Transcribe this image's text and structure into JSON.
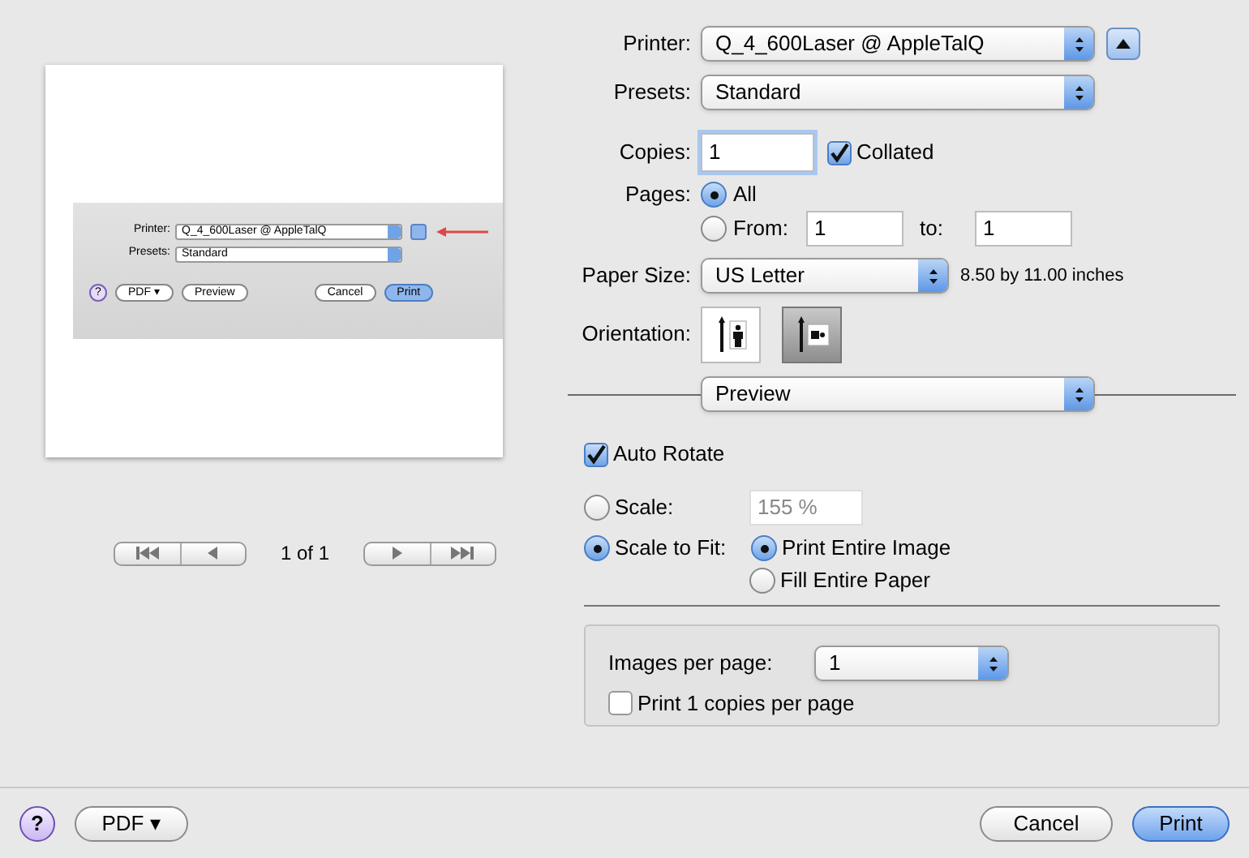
{
  "preview": {
    "screenshot": {
      "printer_label": "Printer:",
      "printer_value": "Q_4_600Laser @ AppleTalQ",
      "presets_label": "Presets:",
      "presets_value": "Standard",
      "help": "?",
      "buttons": [
        {
          "label": "PDF ▾",
          "kind": "plain"
        },
        {
          "label": "Preview",
          "kind": "plain"
        },
        {
          "label": "Cancel",
          "kind": "plain"
        },
        {
          "label": "Print",
          "kind": "default"
        }
      ]
    },
    "page_indicator": "1 of 1"
  },
  "printer": {
    "label": "Printer:",
    "value": "Q_4_600Laser @ AppleTalQ"
  },
  "presets": {
    "label": "Presets:",
    "value": "Standard"
  },
  "copies": {
    "label": "Copies:",
    "value": "1"
  },
  "collated": {
    "label": "Collated",
    "checked": true
  },
  "pages": {
    "label": "Pages:",
    "options": [
      {
        "label": "All",
        "selected": true
      },
      {
        "label": "From:",
        "selected": false
      }
    ],
    "from": "1",
    "to_label": "to:",
    "to": "1"
  },
  "paper_size": {
    "label": "Paper Size:",
    "value": "US Letter",
    "dimensions": "8.50 by 11.00 inches"
  },
  "orientation": {
    "label": "Orientation:",
    "options": [
      {
        "kind": "portrait",
        "selected": false
      },
      {
        "kind": "landscape",
        "selected": true
      }
    ]
  },
  "section": "Preview",
  "auto_rotate": {
    "label": "Auto Rotate",
    "checked": true
  },
  "scale": {
    "options": [
      {
        "label": "Scale:",
        "selected": false
      },
      {
        "label": "Scale to Fit:",
        "selected": true
      }
    ],
    "value": "155 %",
    "fit_options": [
      {
        "label": "Print Entire Image",
        "selected": true
      },
      {
        "label": "Fill Entire Paper",
        "selected": false
      }
    ]
  },
  "images_per_page": {
    "label": "Images per page:",
    "value": "1"
  },
  "copies_per_page": {
    "label": "Print 1 copies per page",
    "checked": false
  },
  "help": "?",
  "pdf": "PDF ▾",
  "buttons": [
    {
      "label": "Cancel",
      "kind": "plain"
    },
    {
      "label": "Print",
      "kind": "default"
    }
  ]
}
